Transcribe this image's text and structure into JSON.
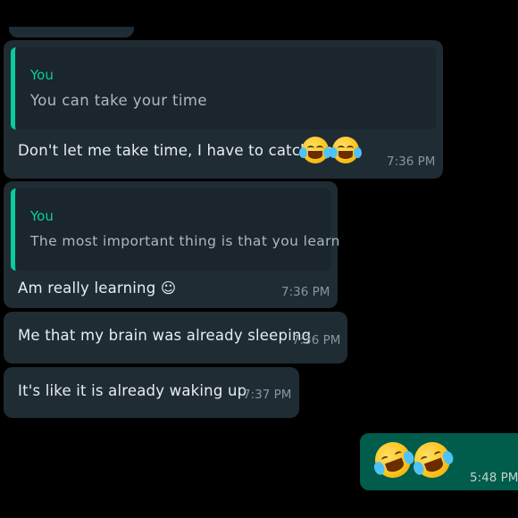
{
  "colors": {
    "background": "#000000",
    "incoming_bubble": "#1f2c34",
    "outgoing_bubble": "#005c4b",
    "quote_accent": "#06cf9c",
    "timestamp": "#8696a0"
  },
  "messages": [
    {
      "direction": "incoming",
      "reply": {
        "author": "You",
        "text": "You can take your time"
      },
      "text": "Don't let me take time, I have to catch up",
      "emojis": [
        "face-with-tears-of-joy",
        "face-with-tears-of-joy"
      ],
      "time": "7:36 PM"
    },
    {
      "direction": "incoming",
      "reply": {
        "author": "You",
        "text": "The most important thing is that you learn"
      },
      "text": "Am really learning ☺",
      "time": "7:36 PM"
    },
    {
      "direction": "incoming",
      "text": "Me that my brain was already sleeping",
      "time": "7:36 PM"
    },
    {
      "direction": "incoming",
      "text": "It's like it is already waking up",
      "time": "7:37 PM"
    },
    {
      "direction": "outgoing",
      "emojis": [
        "rolling-on-the-floor-laughing",
        "rolling-on-the-floor-laughing"
      ],
      "time": "5:48 PM"
    }
  ]
}
